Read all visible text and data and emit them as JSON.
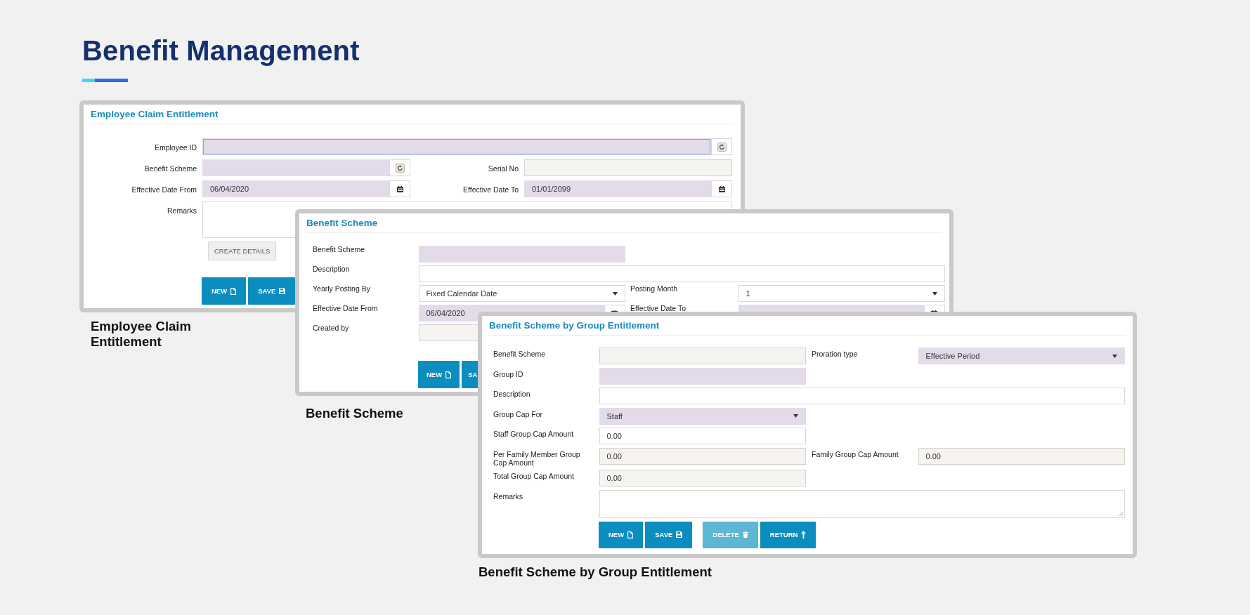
{
  "page": {
    "title": "Benefit Management"
  },
  "windows": [
    {
      "title": "Employee Claim Entitlement",
      "caption": "Employee Claim Entitlement",
      "rows": [
        [
          {
            "label": "Employee ID",
            "kind": "lookup",
            "required": true,
            "readonly": false,
            "focused": true
          }
        ],
        [
          {
            "label": "Benefit Scheme",
            "kind": "lookup",
            "required": true,
            "readonly": false,
            "focused": false
          },
          {
            "label": "Serial No",
            "kind": "text",
            "required": false,
            "readonly": true,
            "focused": false
          }
        ],
        [
          {
            "label": "Effective Date From",
            "kind": "date",
            "value": "06/04/2020",
            "required": true,
            "readonly": false,
            "focused": false
          },
          {
            "label": "Effective Date To",
            "kind": "date",
            "value": "01/01/2099",
            "required": true,
            "readonly": false,
            "focused": false
          }
        ],
        [
          {
            "label": "Remarks",
            "kind": "textarea",
            "required": false,
            "readonly": false,
            "focused": false
          }
        ]
      ],
      "buttons": [
        {
          "label": "CREATE DETAILS",
          "kind": "details",
          "disabled": false
        },
        {
          "label": "NEW",
          "kind": "new",
          "disabled": false
        },
        {
          "label": "SAVE",
          "kind": "save",
          "disabled": false
        }
      ]
    },
    {
      "title": "Benefit Scheme",
      "caption": "Benefit Scheme",
      "rows": [
        [
          {
            "label": "Benefit Scheme",
            "kind": "text",
            "required": true,
            "readonly": false,
            "focused": false
          }
        ],
        [
          {
            "label": "Description",
            "kind": "text",
            "required": false,
            "readonly": false,
            "focused": false
          }
        ],
        [
          {
            "label": "Yearly Posting By",
            "kind": "select",
            "value": "Fixed Calendar Date",
            "required": false,
            "readonly": false,
            "focused": false
          },
          {
            "label": "Posting Month",
            "kind": "select",
            "value": "1",
            "required": false,
            "readonly": false,
            "focused": false
          }
        ],
        [
          {
            "label": "Effective Date From",
            "kind": "date",
            "value": "06/04/2020",
            "required": true,
            "readonly": false,
            "focused": false
          },
          {
            "label": "Effective Date To",
            "kind": "date",
            "required": true,
            "readonly": false,
            "focused": false
          }
        ],
        [
          {
            "label": "Created by",
            "kind": "text",
            "required": false,
            "readonly": true,
            "focused": false
          }
        ]
      ],
      "buttons": [
        {
          "label": "NEW",
          "kind": "new",
          "disabled": false
        },
        {
          "label": "SA",
          "kind": "save",
          "disabled": false
        }
      ]
    },
    {
      "title": "Benefit Scheme by Group Entitlement",
      "caption": "Benefit Scheme by Group Entitlement",
      "rows": [
        [
          {
            "label": "Benefit Scheme",
            "kind": "text",
            "required": false,
            "readonly": true,
            "focused": false
          },
          {
            "label": "Proration type",
            "kind": "select",
            "value": "Effective Period",
            "required": true,
            "readonly": false,
            "focused": false
          }
        ],
        [
          {
            "label": "Group ID",
            "kind": "text",
            "required": true,
            "readonly": false,
            "focused": false
          }
        ],
        [
          {
            "label": "Description",
            "kind": "text",
            "required": false,
            "readonly": false,
            "focused": false
          }
        ],
        [
          {
            "label": "Group Cap For",
            "kind": "select",
            "value": "Staff",
            "required": true,
            "readonly": false,
            "focused": false
          }
        ],
        [
          {
            "label": "Staff Group Cap Amount",
            "kind": "text",
            "value": "0.00",
            "required": false,
            "readonly": false,
            "focused": false
          }
        ],
        [
          {
            "label": "Per Family Member Group Cap Amount",
            "kind": "text",
            "value": "0.00",
            "required": false,
            "readonly": true,
            "focused": false
          },
          {
            "label": "Family Group Cap Amount",
            "kind": "text",
            "value": "0.00",
            "required": false,
            "readonly": true,
            "focused": false
          }
        ],
        [
          {
            "label": "Total Group Cap Amount",
            "kind": "text",
            "value": "0.00",
            "required": false,
            "readonly": true,
            "focused": false
          }
        ],
        [
          {
            "label": "Remarks",
            "kind": "textarea",
            "required": false,
            "readonly": false,
            "focused": false
          }
        ]
      ],
      "buttons": [
        {
          "label": "NEW",
          "kind": "new",
          "disabled": false
        },
        {
          "label": "SAVE",
          "kind": "save",
          "disabled": false
        },
        {
          "label": "DELETE",
          "kind": "delete",
          "disabled": true
        },
        {
          "label": "RETURN",
          "kind": "return",
          "disabled": false
        }
      ]
    }
  ]
}
